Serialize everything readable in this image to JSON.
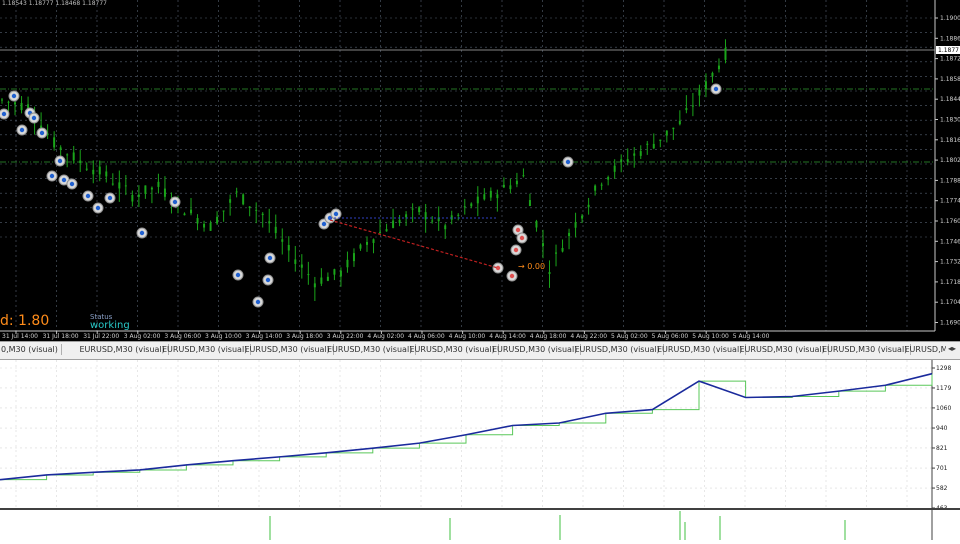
{
  "chart_header": {
    "ohlc_text": "1.18543 1.18777 1.18468 1.18777"
  },
  "price_axis": {
    "labels": [
      "1.1900",
      "1.1886",
      "1.1872",
      "1.1858",
      "1.1844",
      "1.1830",
      "1.1816",
      "1.1802",
      "1.1788",
      "1.1774",
      "1.1760",
      "1.1746",
      "1.1732",
      "1.1718",
      "1.1704",
      "1.1690"
    ],
    "current_price_label": "1.1877"
  },
  "time_axis": {
    "labels": [
      "31 Jul 14:00",
      "31 Jul 18:00",
      "31 Jul 22:00",
      "3 Aug 02:00",
      "3 Aug 06:00",
      "3 Aug 10:00",
      "3 Aug 14:00",
      "3 Aug 18:00",
      "3 Aug 22:00",
      "4 Aug 02:00",
      "4 Aug 06:00",
      "4 Aug 10:00",
      "4 Aug 14:00",
      "4 Aug 18:00",
      "4 Aug 22:00",
      "5 Aug 02:00",
      "5 Aug 06:00",
      "5 Aug 10:00",
      "5 Aug 14:00"
    ]
  },
  "overlay": {
    "main_value": "d: 1.80",
    "status_label": "Status",
    "status_value": "working",
    "trade_label": "→ 0.00",
    "colors": {
      "main": "#ff8c1a",
      "status_label": "#8aa0c8",
      "status_value": "#28c8c8"
    }
  },
  "tabs": [
    {
      "label": "0,M30 (visual)"
    },
    {
      "label": "EURUSD,M30 (visual)"
    },
    {
      "label": "EURUSD,M30 (visual)"
    },
    {
      "label": "EURUSD,M30 (visual)"
    },
    {
      "label": "EURUSD,M30 (visual)"
    },
    {
      "label": "EURUSD,M30 (visual)"
    },
    {
      "label": "EURUSD,M30 (visual)"
    },
    {
      "label": "EURUSD,M30 (visual)"
    },
    {
      "label": "EURUSD,M30 (visual)"
    },
    {
      "label": "EURUSD,M30 (visual)"
    },
    {
      "label": "EURUSD,M30 (visual)"
    },
    {
      "label": "EURUSD,M30 (visual)"
    }
  ],
  "equity_axis": {
    "labels": [
      "1298",
      "1179",
      "1060",
      "940",
      "821",
      "701",
      "582",
      "463"
    ]
  },
  "colors": {
    "candle": "#1aa51a",
    "grid": "#556070",
    "equity_line": "#1a2a9c",
    "balance_line": "#5ac85a"
  },
  "chart_data": [
    {
      "type": "line",
      "name": "price",
      "x": [
        0,
        4,
        8,
        12,
        16,
        20,
        24,
        28,
        32,
        36,
        40,
        44,
        48,
        52,
        56,
        60,
        64,
        68,
        72,
        76,
        80,
        84,
        88,
        92,
        96,
        100,
        104,
        108,
        112
      ],
      "values": [
        1.184,
        1.1836,
        1.1812,
        1.18,
        1.1791,
        1.1778,
        1.1784,
        1.1769,
        1.1758,
        1.1779,
        1.1766,
        1.1742,
        1.1722,
        1.1728,
        1.1748,
        1.176,
        1.1768,
        1.1758,
        1.1772,
        1.178,
        1.179,
        1.1731,
        1.176,
        1.1788,
        1.1802,
        1.1812,
        1.1825,
        1.185,
        1.1877
      ],
      "ylim": [
        1.169,
        1.19
      ]
    },
    {
      "type": "line",
      "name": "equity",
      "x": [
        0,
        5,
        10,
        15,
        20,
        25,
        30,
        35,
        40,
        45,
        50,
        55,
        60,
        65,
        70,
        75,
        80,
        85,
        90,
        95,
        100
      ],
      "values": [
        632,
        660,
        676,
        690,
        720,
        745,
        768,
        792,
        820,
        850,
        900,
        955,
        970,
        1028,
        1050,
        1220,
        1122,
        1128,
        1160,
        1195,
        1264
      ],
      "ylim": [
        463,
        1298
      ]
    }
  ]
}
